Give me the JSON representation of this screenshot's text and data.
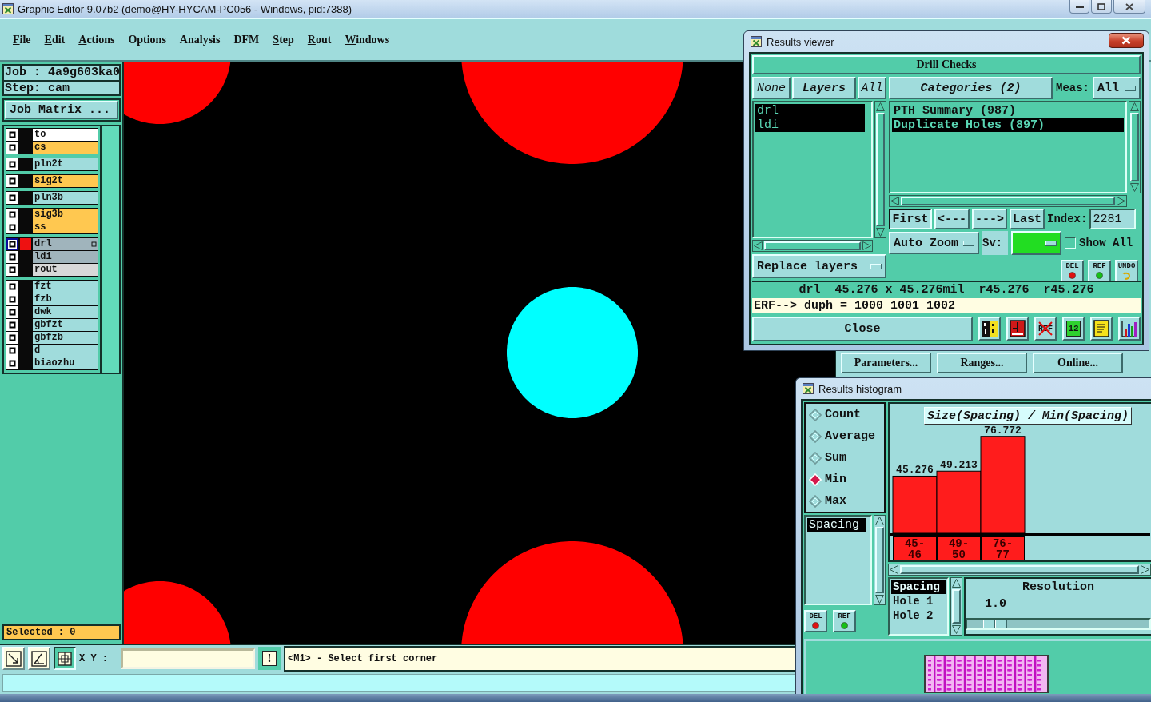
{
  "window": {
    "title": "Graphic Editor 9.07b2 (demo@HY-HYCAM-PC056 - Windows, pid:7388)"
  },
  "menu": [
    {
      "label": "File",
      "underlined": true
    },
    {
      "label": "Edit",
      "underlined": true
    },
    {
      "label": "Actions",
      "underlined": true
    },
    {
      "label": "Options",
      "underlined": false
    },
    {
      "label": "Analysis",
      "underlined": false
    },
    {
      "label": "DFM",
      "underlined": false
    },
    {
      "label": "Step",
      "underlined": true
    },
    {
      "label": "Rout",
      "underlined": true
    },
    {
      "label": "Windows",
      "underlined": true
    }
  ],
  "job_panel": {
    "job": "Job : 4a9g603ka0",
    "step": "Step: cam",
    "matrix_button": "Job Matrix ..."
  },
  "layer_groups": [
    {
      "layers": [
        {
          "name": "to",
          "color": "#ffffff",
          "selected": false,
          "displayed": false
        },
        {
          "name": "cs",
          "color": "#ffc850",
          "selected": false,
          "displayed": false
        }
      ]
    },
    {
      "layers": [
        {
          "name": "pln2t",
          "color": "#a0dcdc",
          "selected": false,
          "displayed": false
        }
      ]
    },
    {
      "layers": [
        {
          "name": "sig2t",
          "color": "#ffc850",
          "selected": false,
          "displayed": false
        }
      ]
    },
    {
      "layers": [
        {
          "name": "pln3b",
          "color": "#a0dcdc",
          "selected": false,
          "displayed": false
        }
      ]
    },
    {
      "layers": [
        {
          "name": "sig3b",
          "color": "#ffc850",
          "selected": false,
          "displayed": false
        },
        {
          "name": "ss",
          "color": "#ffc850",
          "selected": false,
          "displayed": false
        }
      ]
    },
    {
      "layers": [
        {
          "name": "drl",
          "color": "#a0b4bc",
          "selected": true,
          "displayed": true
        },
        {
          "name": "ldi",
          "color": "#a0b4bc",
          "selected": false,
          "displayed": false
        },
        {
          "name": "rout",
          "color": "#d8d8d8",
          "selected": false,
          "displayed": false
        }
      ]
    },
    {
      "layers": [
        {
          "name": "fzt",
          "color": "#a0dcdc",
          "selected": false,
          "displayed": false
        },
        {
          "name": "fzb",
          "color": "#a0dcdc",
          "selected": false,
          "displayed": false
        },
        {
          "name": "dwk",
          "color": "#a0dcdc",
          "selected": false,
          "displayed": false
        },
        {
          "name": "gbfzt",
          "color": "#a0dcdc",
          "selected": false,
          "displayed": false
        },
        {
          "name": "gbfzb",
          "color": "#a0dcdc",
          "selected": false,
          "displayed": false
        },
        {
          "name": "d",
          "color": "#a0dcdc",
          "selected": false,
          "displayed": false
        },
        {
          "name": "biaozhu",
          "color": "#a0dcdc",
          "selected": false,
          "displayed": false
        }
      ]
    }
  ],
  "selected_count": "Selected : 0",
  "canvas": {
    "pads": [
      {
        "highlighted": false
      },
      {
        "highlighted": false
      },
      {
        "highlighted": true
      },
      {
        "highlighted": false
      },
      {
        "highlighted": false
      }
    ]
  },
  "toolbar": {
    "tools": [
      {
        "kind": "diagonal",
        "selected": false
      },
      {
        "kind": "angle",
        "selected": false
      },
      {
        "kind": "grid",
        "selected": true
      }
    ],
    "coords_label": "X Y :",
    "alert_button": "!",
    "message": "<M1> - Select first corner"
  },
  "background_buttons": [
    "Parameters...",
    "Ranges...",
    "Online..."
  ],
  "results_viewer": {
    "title": "Results viewer",
    "header": "Drill Checks",
    "layer_buttons": [
      {
        "label": "None",
        "kind": "button"
      },
      {
        "label": "Layers",
        "kind": "title"
      },
      {
        "label": "All",
        "kind": "button"
      }
    ],
    "layers": [
      {
        "name": "drl",
        "selected": true
      },
      {
        "name": "ldi",
        "selected": true
      }
    ],
    "replace_mode": "Replace layers",
    "categories_button": "Categories (2)",
    "meas_label": "Meas:",
    "meas_value": "All",
    "categories": [
      {
        "name": "PTH Summary (987)",
        "selected": false
      },
      {
        "name": "Duplicate Holes (897)",
        "selected": true
      }
    ],
    "nav_buttons": [
      {
        "label": "First",
        "pressed": true
      },
      {
        "label": "<---",
        "pressed": false
      },
      {
        "label": "--->",
        "pressed": false
      },
      {
        "label": "Last",
        "pressed": false
      }
    ],
    "index_label": "Index:",
    "index_value": "2281",
    "zoom_mode": "Auto Zoom",
    "sv_label": "Sv:",
    "show_all": {
      "label": "Show All",
      "checked": false
    },
    "action_buttons": [
      {
        "label": "DEL",
        "kind": "del"
      },
      {
        "label": "REF",
        "kind": "ref"
      },
      {
        "label": "UNDO",
        "kind": "undo"
      }
    ],
    "measure_line": "drl  45.276 x 45.276mil  r45.276  r45.276",
    "erf_line": "ERF--> duph = 1000 1001 1002",
    "close_button": "Close",
    "tool_buttons": [
      {
        "kind": "figure"
      },
      {
        "kind": "document"
      },
      {
        "kind": "crossed",
        "label": "REF"
      },
      {
        "kind": "numbered",
        "label": "12"
      },
      {
        "kind": "notes"
      },
      {
        "kind": "chart"
      }
    ]
  },
  "results_histogram": {
    "title": "Results histogram",
    "modes": [
      {
        "label": "Count",
        "selected": false
      },
      {
        "label": "Average",
        "selected": false
      },
      {
        "label": "Sum",
        "selected": false
      },
      {
        "label": "Min",
        "selected": true
      },
      {
        "label": "Max",
        "selected": false
      }
    ],
    "measures": [
      {
        "name": "Spacing",
        "selected": true
      }
    ],
    "action_buttons": [
      {
        "label": "DEL",
        "kind": "del"
      },
      {
        "label": "REF",
        "kind": "ref"
      }
    ],
    "chart_data": {
      "type": "bar",
      "title": "Size(Spacing) / Min(Spacing)",
      "categories": [
        "45-46",
        "49-50",
        "76-77"
      ],
      "values": [
        45.276,
        49.213,
        76.772
      ],
      "data_labels": true
    },
    "fields": [
      {
        "name": "Spacing",
        "selected": true
      },
      {
        "name": "Hole 1",
        "selected": false
      },
      {
        "name": "Hole 2",
        "selected": false
      }
    ],
    "resolution": {
      "label": "Resolution",
      "value": "1.0",
      "level": 0.1
    }
  }
}
